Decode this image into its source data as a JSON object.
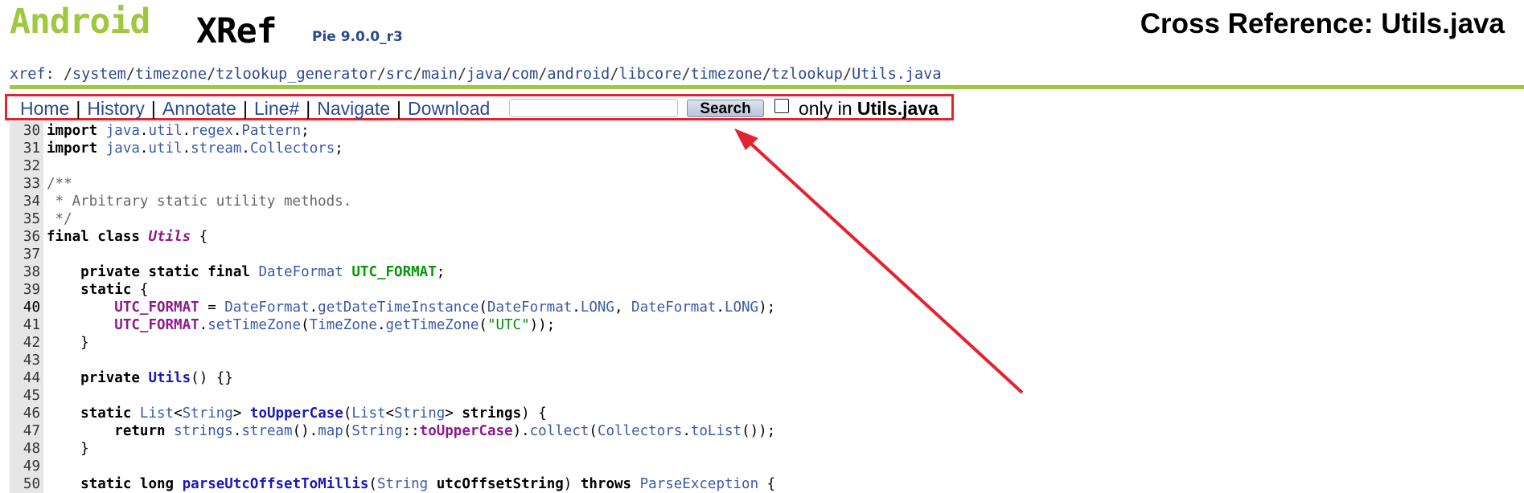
{
  "header": {
    "logo_android": "Android",
    "logo_xref": "XRef",
    "logo_version": "Pie 9.0.0_r3",
    "title": "Cross Reference: Utils.java"
  },
  "breadcrumb": {
    "root": "xref",
    "prefix": ": /",
    "parts": [
      "system",
      "timezone",
      "tzlookup_generator",
      "src",
      "main",
      "java",
      "com",
      "android",
      "libcore",
      "timezone",
      "tzlookup",
      "Utils.java"
    ]
  },
  "toolbar": {
    "links": [
      "Home",
      "History",
      "Annotate",
      "Line#",
      "Navigate",
      "Download"
    ],
    "search_value": "",
    "search_button": "Search",
    "only_in_prefix": "only in ",
    "only_in_file": "Utils.java"
  },
  "code": {
    "highlighted_line": 40,
    "lines": [
      {
        "n": "30",
        "tokens": [
          [
            "k",
            "import"
          ],
          [
            "pl",
            " "
          ],
          [
            "t",
            "java"
          ],
          [
            "pl",
            "."
          ],
          [
            "t",
            "util"
          ],
          [
            "pl",
            "."
          ],
          [
            "t",
            "regex"
          ],
          [
            "pl",
            "."
          ],
          [
            "t",
            "Pattern"
          ],
          [
            "pl",
            ";"
          ]
        ]
      },
      {
        "n": "31",
        "tokens": [
          [
            "k",
            "import"
          ],
          [
            "pl",
            " "
          ],
          [
            "t",
            "java"
          ],
          [
            "pl",
            "."
          ],
          [
            "t",
            "util"
          ],
          [
            "pl",
            "."
          ],
          [
            "t",
            "stream"
          ],
          [
            "pl",
            "."
          ],
          [
            "t",
            "Collectors"
          ],
          [
            "pl",
            ";"
          ]
        ]
      },
      {
        "n": "32",
        "tokens": []
      },
      {
        "n": "33",
        "tokens": [
          [
            "cm",
            "/**"
          ]
        ]
      },
      {
        "n": "34",
        "tokens": [
          [
            "cm",
            " * Arbitrary static utility methods."
          ]
        ]
      },
      {
        "n": "35",
        "tokens": [
          [
            "cm",
            " */"
          ]
        ]
      },
      {
        "n": "36",
        "tokens": [
          [
            "k",
            "final"
          ],
          [
            "pl",
            " "
          ],
          [
            "k",
            "class"
          ],
          [
            "pl",
            " "
          ],
          [
            "cls",
            "Utils"
          ],
          [
            "pl",
            " {"
          ]
        ]
      },
      {
        "n": "37",
        "tokens": []
      },
      {
        "n": "38",
        "tokens": [
          [
            "pl",
            "    "
          ],
          [
            "k",
            "private"
          ],
          [
            "pl",
            " "
          ],
          [
            "k",
            "static"
          ],
          [
            "pl",
            " "
          ],
          [
            "k",
            "final"
          ],
          [
            "pl",
            " "
          ],
          [
            "t",
            "DateFormat"
          ],
          [
            "pl",
            " "
          ],
          [
            "fldg",
            "UTC_FORMAT"
          ],
          [
            "pl",
            ";"
          ]
        ]
      },
      {
        "n": "39",
        "tokens": [
          [
            "pl",
            "    "
          ],
          [
            "k",
            "static"
          ],
          [
            "pl",
            " {"
          ]
        ]
      },
      {
        "n": "40",
        "tokens": [
          [
            "pl",
            "        "
          ],
          [
            "fld",
            "UTC_FORMAT"
          ],
          [
            "pl",
            " = "
          ],
          [
            "t",
            "DateFormat"
          ],
          [
            "pl",
            "."
          ],
          [
            "t",
            "getDateTimeInstance"
          ],
          [
            "pl",
            "("
          ],
          [
            "t",
            "DateFormat"
          ],
          [
            "pl",
            "."
          ],
          [
            "t",
            "LONG"
          ],
          [
            "pl",
            ", "
          ],
          [
            "t",
            "DateFormat"
          ],
          [
            "pl",
            "."
          ],
          [
            "t",
            "LONG"
          ],
          [
            "pl",
            ");"
          ]
        ]
      },
      {
        "n": "41",
        "tokens": [
          [
            "pl",
            "        "
          ],
          [
            "fld",
            "UTC_FORMAT"
          ],
          [
            "pl",
            "."
          ],
          [
            "t",
            "setTimeZone"
          ],
          [
            "pl",
            "("
          ],
          [
            "t",
            "TimeZone"
          ],
          [
            "pl",
            "."
          ],
          [
            "t",
            "getTimeZone"
          ],
          [
            "pl",
            "("
          ],
          [
            "str",
            "\"UTC\""
          ],
          [
            "pl",
            "));"
          ]
        ]
      },
      {
        "n": "42",
        "tokens": [
          [
            "pl",
            "    }"
          ]
        ]
      },
      {
        "n": "43",
        "tokens": []
      },
      {
        "n": "44",
        "tokens": [
          [
            "pl",
            "    "
          ],
          [
            "k",
            "private"
          ],
          [
            "pl",
            " "
          ],
          [
            "fn",
            "Utils"
          ],
          [
            "pl",
            "() {}"
          ]
        ]
      },
      {
        "n": "45",
        "tokens": []
      },
      {
        "n": "46",
        "tokens": [
          [
            "pl",
            "    "
          ],
          [
            "k",
            "static"
          ],
          [
            "pl",
            " "
          ],
          [
            "t",
            "List"
          ],
          [
            "pl",
            "<"
          ],
          [
            "t",
            "String"
          ],
          [
            "pl",
            "> "
          ],
          [
            "fn",
            "toUpperCase"
          ],
          [
            "pl",
            "("
          ],
          [
            "t",
            "List"
          ],
          [
            "pl",
            "<"
          ],
          [
            "t",
            "String"
          ],
          [
            "pl",
            "> "
          ],
          [
            "par",
            "strings"
          ],
          [
            "pl",
            ") {"
          ]
        ]
      },
      {
        "n": "47",
        "tokens": [
          [
            "pl",
            "        "
          ],
          [
            "k",
            "return"
          ],
          [
            "pl",
            " "
          ],
          [
            "t",
            "strings"
          ],
          [
            "pl",
            "."
          ],
          [
            "t",
            "stream"
          ],
          [
            "pl",
            "()."
          ],
          [
            "t",
            "map"
          ],
          [
            "pl",
            "("
          ],
          [
            "t",
            "String"
          ],
          [
            "pl",
            "::"
          ],
          [
            "fld",
            "toUpperCase"
          ],
          [
            "pl",
            ")."
          ],
          [
            "t",
            "collect"
          ],
          [
            "pl",
            "("
          ],
          [
            "t",
            "Collectors"
          ],
          [
            "pl",
            "."
          ],
          [
            "t",
            "toList"
          ],
          [
            "pl",
            "());"
          ]
        ]
      },
      {
        "n": "48",
        "tokens": [
          [
            "pl",
            "    }"
          ]
        ]
      },
      {
        "n": "49",
        "tokens": []
      },
      {
        "n": "50",
        "tokens": [
          [
            "pl",
            "    "
          ],
          [
            "k",
            "static"
          ],
          [
            "pl",
            " "
          ],
          [
            "k",
            "long"
          ],
          [
            "pl",
            " "
          ],
          [
            "fn",
            "parseUtcOffsetToMillis"
          ],
          [
            "pl",
            "("
          ],
          [
            "t",
            "String"
          ],
          [
            "pl",
            " "
          ],
          [
            "par",
            "utcOffsetString"
          ],
          [
            "pl",
            ") "
          ],
          [
            "k",
            "throws"
          ],
          [
            "pl",
            " "
          ],
          [
            "t",
            "ParseException"
          ],
          [
            "pl",
            " {"
          ]
        ]
      }
    ]
  },
  "colors": {
    "accent_green": "#9fc73f",
    "link_blue": "#2a4b8f",
    "annotation_red": "#e3232f"
  }
}
